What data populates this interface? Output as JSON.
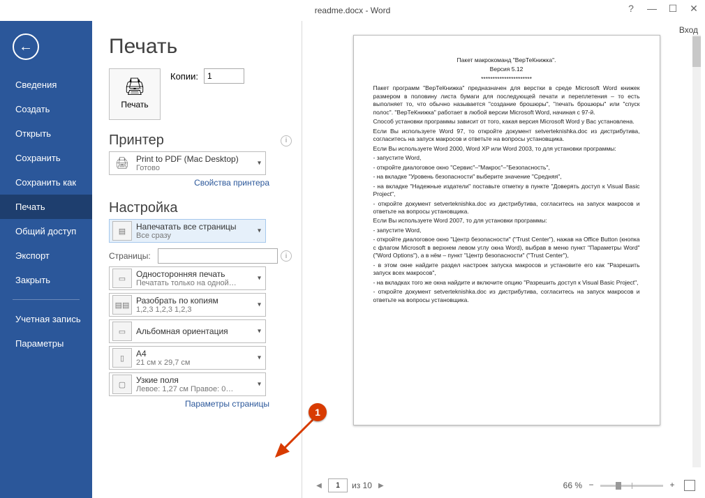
{
  "titlebar": {
    "title": "readme.docx - Word",
    "login": "Вход"
  },
  "sidebar": {
    "items": [
      "Сведения",
      "Создать",
      "Открыть",
      "Сохранить",
      "Сохранить как",
      "Печать",
      "Общий доступ",
      "Экспорт",
      "Закрыть"
    ],
    "account": "Учетная запись",
    "options": "Параметры"
  },
  "print": {
    "title": "Печать",
    "button": "Печать",
    "copies_label": "Копии:",
    "copies_value": "1",
    "printer_head": "Принтер",
    "printer_name": "Print to PDF (Mac Desktop)",
    "printer_status": "Готово",
    "printer_props": "Свойства принтера",
    "settings_head": "Настройка",
    "pages_label": "Страницы:",
    "page_setup": "Параметры страницы",
    "dd": {
      "all": {
        "l1": "Напечатать все страницы",
        "l2": "Все сразу"
      },
      "side": {
        "l1": "Односторонняя печать",
        "l2": "Печатать только на одной…"
      },
      "collate": {
        "l1": "Разобрать по копиям",
        "l2": "1,2,3   1,2,3   1,2,3"
      },
      "orient": {
        "l1": "Альбомная ориентация",
        "l2": ""
      },
      "paper": {
        "l1": "A4",
        "l2": "21 см x 29,7 см"
      },
      "margins": {
        "l1": "Узкие поля",
        "l2": "Левое:  1,27 см   Правое:  0…"
      }
    }
  },
  "status": {
    "page": "1",
    "total": "из 10",
    "zoom": "66 %",
    "zoom_marks": {
      "minus": "−",
      "plus": "+"
    }
  },
  "callout": "1",
  "doc": {
    "l1": "Пакет макрокоманд \"ВерТеКнижка\".",
    "l2": "Версия 5.12",
    "l3": "**********************",
    "p1": "Пакет программ \"ВерТеКнижка\" предназначен для верстки в среде Microsoft Word книжек размером в половину листа бумаги для последующей печати и переплетения – то есть выполняет то, что обычно называется \"создание брошюры\", \"печать брошюры\" или \"спуск полос\". \"ВерТеКнижка\" работает в любой версии Microsoft Word, начиная с 97-й.",
    "p2": "Способ установки программы зависит от того, какая версия Microsoft Word у Вас установлена.",
    "p3": "Если Вы используете Word 97, то откройте документ setverteknishka.doc из дистрибутива, согласитесь на запуск макросов и ответьте на вопросы установщика.",
    "p4": "Если Вы используете Word 2000, Word XP или Word 2003, то для установки программы:",
    "p5": "- запустите Word,",
    "p6": "- откройте диалоговое окно \"Сервис\"–\"Макрос\"–\"Безопасность\",",
    "p7": "- на вкладке \"Уровень безопасности\" выберите значение \"Средняя\",",
    "p8": "- на вкладке \"Надежные издатели\" поставьте отметку в пункте \"Доверять доступ к Visual Basic Project\",",
    "p9": "- откройте документ setverteknishka.doc из дистрибутива, согласитесь на запуск макросов и ответьте на вопросы установщика.",
    "p10": "Если Вы используете Word 2007, то для установки программы:",
    "p11": "- запустите Word,",
    "p12": "- откройте диалоговое окно \"Центр безопасности\" (\"Trust Center\"), нажав на Office Button (кнопка с флагом Microsoft в верхнем левом углу окна Word), выбрав в меню пункт \"Параметры Word\" (\"Word Options\"), а в нём – пункт \"Центр безопасности\" (\"Trust Center\"),",
    "p13": "- в этом окне найдите раздел настроек запуска макросов и установите его как \"Разрешить запуск всех макросов\",",
    "p14": "- на вкладках того же окна найдите и включите опцию \"Разрешить доступ к Visual Basic Project\",",
    "p15": "- откройте документ setverteknishka.doc из дистрибутива, согласитесь на запуск макросов и ответьте на вопросы установщика."
  }
}
